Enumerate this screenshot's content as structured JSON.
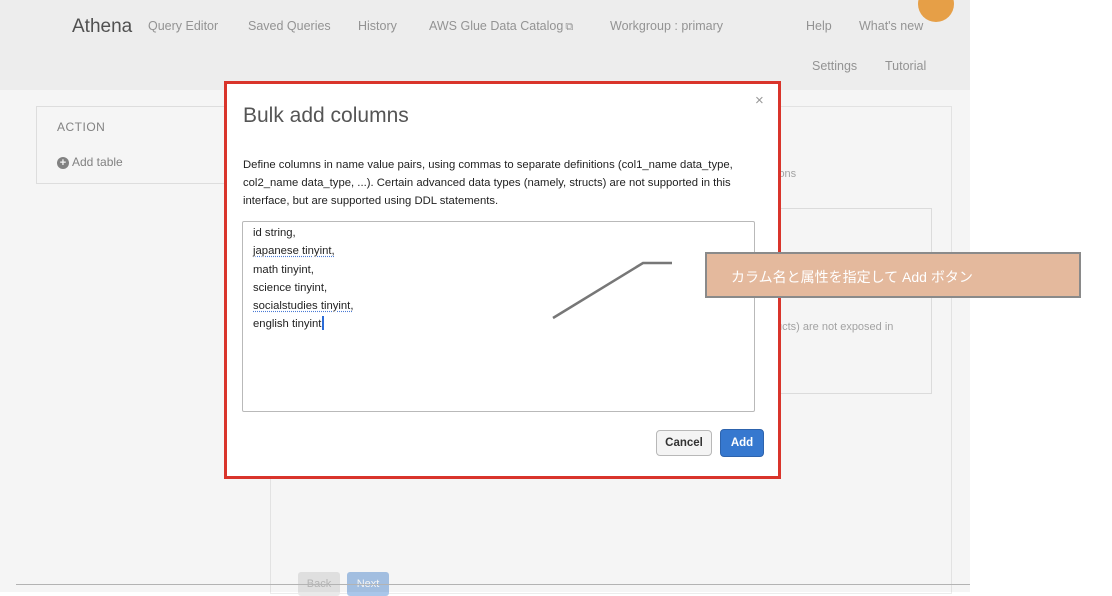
{
  "app": {
    "brand": "Athena",
    "nav": [
      "Query Editor",
      "Saved Queries",
      "History",
      "AWS Glue Data Catalog",
      "Workgroup : primary",
      "Help",
      "What's new"
    ],
    "subnav": [
      "Settings",
      "Tutorial"
    ]
  },
  "sidebar": {
    "action_label": "ACTION",
    "add_table": "Add table"
  },
  "background_fragments": {
    "ions": "ions",
    "structs": "ucts) are not exposed in",
    "back": "Back",
    "next": "Next"
  },
  "modal": {
    "title": "Bulk add columns",
    "close": "×",
    "description": "Define columns in name value pairs, using commas to separate definitions (col1_name data_type, col2_name data_type, ...). Certain advanced data types (namely, structs) are not supported in this interface, but are supported using DDL statements.",
    "lines": [
      "id string,",
      "japanese tinyint,",
      "math tinyint,",
      "science tinyint,",
      "socialstudies tinyint,",
      "english tinyint"
    ],
    "cancel_label": "Cancel",
    "add_label": "Add"
  },
  "annotation": {
    "text": "カラム名と属性を指定して Add ボタン"
  },
  "colors": {
    "highlight_border": "#d9342b",
    "primary_button": "#3678cf",
    "callout_fill": "#e4b99d"
  }
}
